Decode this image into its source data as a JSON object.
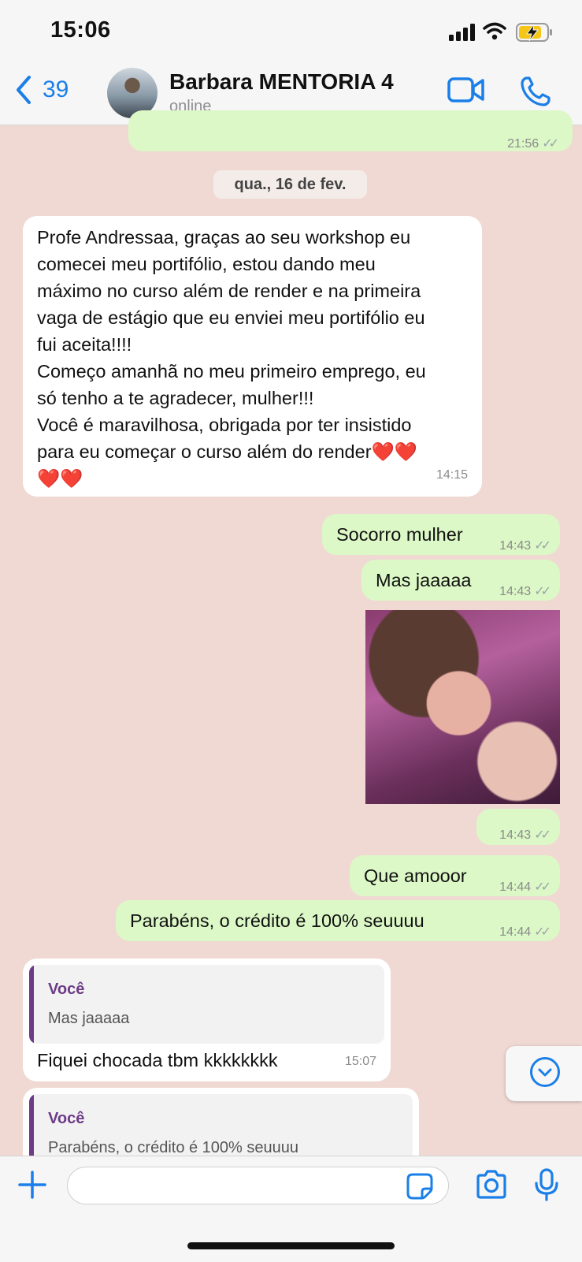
{
  "status_bar": {
    "time": "15:06"
  },
  "header": {
    "back_count": "39",
    "contact_name": "Barbara MENTORIA 4",
    "contact_status": "online"
  },
  "messages": {
    "prev_out_time": "21:56",
    "date_chip": "qua., 16 de fev.",
    "m1_text": "Profe Andressaa, graças ao seu workshop eu\ncomecei meu portifólio, estou dando meu\nmáximo no curso além de render e na primeira\nvaga de estágio que eu enviei meu portifólio eu\nfui aceita!!!!\nComeço amanhã no meu primeiro emprego, eu\nsó tenho a te agradecer, mulher!!!\nVocê é maravilhosa, obrigada por ter insistido\npara eu começar o curso além do render❤️❤️\n❤️❤️",
    "m1_time": "14:15",
    "m2_text": "Socorro mulher",
    "m2_time": "14:43",
    "m3_text": "Mas jaaaaa",
    "m3_time": "14:43",
    "m4_time": "14:43",
    "m5_text": "Que amooor",
    "m5_time": "14:44",
    "m6_text": "Parabéns, o crédito é 100% seuuuu",
    "m6_time": "14:44",
    "r1_quote_author": "Você",
    "r1_quote_text": "Mas jaaaaa",
    "r1_text": "Fiquei chocada tbm kkkkkkkk",
    "r1_time": "15:07",
    "r2_quote_author": "Você",
    "r2_quote_text": "Parabéns, o crédito é 100% seuuuu"
  },
  "input": {
    "placeholder": ""
  },
  "colors": {
    "accent": "#1a7fe8",
    "outgoing_bubble": "#dcf8c6",
    "incoming_bubble": "#ffffff",
    "chat_background": "#f0d9d3",
    "quote_author": "#6d3b87"
  }
}
